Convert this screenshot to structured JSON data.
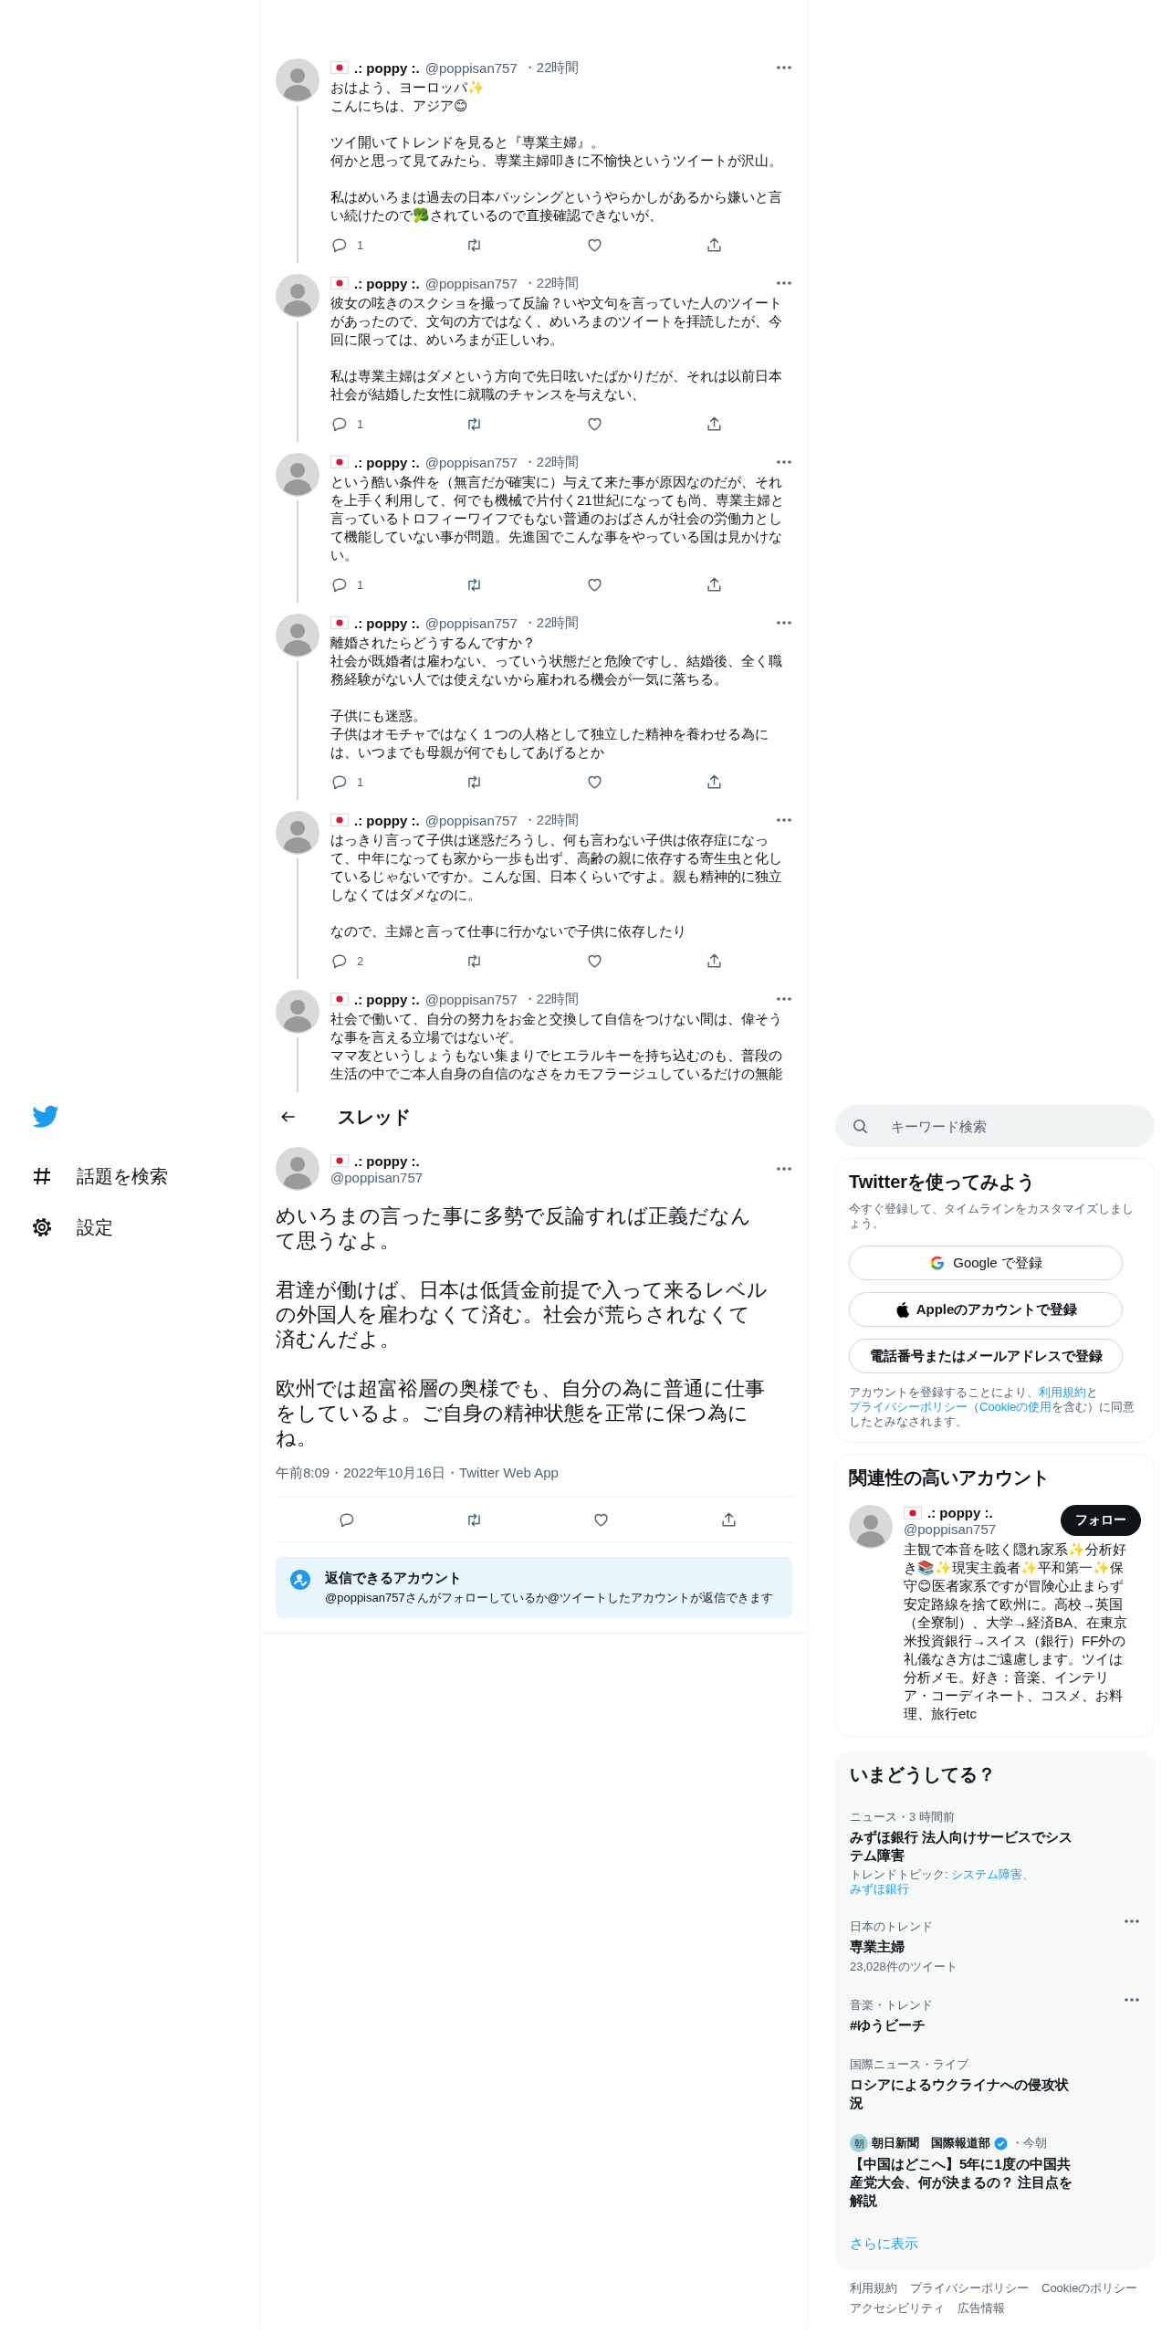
{
  "timeline": [
    {
      "name": ".: poppy :.",
      "handle": "@poppisan757",
      "time": "・22時間",
      "paragraphs": [
        [
          "おはよう、ヨーロッパ✨",
          "こんにちは、アジア😊"
        ],
        [
          "ツイ開いてトレンドを見ると『専業主婦』。",
          "何かと思って見てみたら、専業主婦叩きに不愉快というツイートが沢山。"
        ],
        [
          "私はめいろまは過去の日本バッシングというやらかしがあるから嫌いと言い続けたので🥦されているので直接確認できないが、"
        ]
      ],
      "actions": true,
      "replies": "1"
    },
    {
      "name": ".: poppy :.",
      "handle": "@poppisan757",
      "time": "・22時間",
      "paragraphs": [
        [
          "彼女の呟きのスクショを撮って反論？いや文句を言っていた人のツイートがあったので、文句の方ではなく、めいろまのツイートを拝読したが、今回に限っては、めいろまが正しいわ。"
        ],
        [
          "私は専業主婦はダメという方向で先日呟いたばかりだが、それは以前日本社会が結婚した女性に就職のチャンスを与えない、"
        ]
      ],
      "actions": true,
      "replies": "1"
    },
    {
      "name": ".: poppy :.",
      "handle": "@poppisan757",
      "time": "・22時間",
      "paragraphs": [
        [
          "という酷い条件を（無言だが確実に）与えて来た事が原因なのだが、それを上手く利用して、何でも機械で片付く21世紀になっても尚、専業主婦と言っているトロフィーワイフでもない普通のおばさんが社会の労働力として機能していない事が問題。先進国でこんな事をやっている国は見かけない。"
        ]
      ],
      "actions": true,
      "replies": "1"
    },
    {
      "name": ".: poppy :.",
      "handle": "@poppisan757",
      "time": "・22時間",
      "paragraphs": [
        [
          "離婚されたらどうするんですか？",
          "社会が既婚者は雇わない、っていう状態だと危険ですし、結婚後、全く職務経験がない人では使えないから雇われる機会が一気に落ちる。"
        ],
        [
          "子供にも迷惑。",
          "子供はオモチャではなく１つの人格として独立した精神を養わせる為には、いつまでも母親が何でもしてあげるとか"
        ]
      ],
      "actions": true,
      "replies": "1"
    },
    {
      "name": ".: poppy :.",
      "handle": "@poppisan757",
      "time": "・22時間",
      "paragraphs": [
        [
          "はっきり言って子供は迷惑だろうし、何も言わない子供は依存症になって、中年になっても家から一歩も出ず、高齢の親に依存する寄生虫と化しているじゃないですか。こんな国、日本くらいですよ。親も精神的に独立しなくてはダメなのに。"
        ],
        [
          "なので、主婦と言って仕事に行かないで子供に依存したり"
        ]
      ],
      "actions": true,
      "replies": "2"
    },
    {
      "name": ".: poppy :.",
      "handle": "@poppisan757",
      "time": "・22時間",
      "paragraphs": [
        [
          "社会で働いて、自分の努力をお金と交換して自信をつけない間は、偉そうな事を言える立場ではないぞ。",
          "ママ友というしょうもない集まりでヒエラルキーを持ち込むのも、普段の生活の中でご本人自身の自信のなさをカモフラージュしているだけの無能"
        ]
      ],
      "actions": false
    }
  ],
  "nav": [
    {
      "kind": "explore",
      "label": "話題を検索"
    },
    {
      "kind": "settings",
      "label": "設定"
    }
  ],
  "thread_header": {
    "title": "スレッド"
  },
  "main_tweet": {
    "name": ".: poppy :.",
    "handle": "@poppisan757",
    "paragraphs": [
      "めいろまの言った事に多勢で反論すれば正義だなんて思うなよ。",
      "君達が働けば、日本は低賃金前提で入って来るレベルの外国人を雇わなくて済む。社会が荒らされなくて済むんだよ。",
      "欧州では超富裕層の奥様でも、自分の為に普通に仕事をしているよ。ご自身の精神状態を正常に保つ為にね。"
    ],
    "meta": "午前8:09・2022年10月16日・Twitter Web App"
  },
  "reply_notice": {
    "title": "返信できるアカウント",
    "text": "@poppisan757さんがフォローしているか@ツイートしたアカウントが返信できます"
  },
  "search": {
    "placeholder": "キーワード検索"
  },
  "signup": {
    "title": "Twitterを使ってみよう",
    "subtitle": "今すぐ登録して、タイムラインをカスタマイズしましょう。",
    "buttons": [
      {
        "kind": "google",
        "label": "Google で登録"
      },
      {
        "kind": "apple",
        "label": "Appleのアカウントで登録"
      },
      {
        "kind": "phone",
        "label": "電話番号またはメールアドレスで登録"
      }
    ],
    "legal": [
      {
        "text": "アカウントを登録することにより、",
        "link": false
      },
      {
        "text": "利用規約",
        "link": true
      },
      {
        "text": "と",
        "link": false
      },
      {
        "text": "プライバシーポリシー",
        "link": true
      },
      {
        "text": "（",
        "link": false
      },
      {
        "text": "Cookieの使用",
        "link": true
      },
      {
        "text": "を含む）に同意したとみなされます。",
        "link": false
      }
    ]
  },
  "who_to_follow": {
    "title": "関連性の高いアカウント",
    "accounts": [
      {
        "name": ".: poppy :.",
        "handle": "@poppisan757",
        "button": "フォロー",
        "bio": "主観で本音を呟く隠れ家系✨分析好き📚✨現実主義者✨平和第一✨保守😊医者家系ですが冒険心止まらず安定路線を捨て欧州に。高校→英国（全寮制）、大学→経済BA、在東京米投資銀行→スイス（銀行）FF外の礼儀なき方はご遠慮します。ツイは分析メモ。好き：音楽、インテリア・コーディネート、コスメ、お料理、旅行etc"
      }
    ]
  },
  "trends": {
    "title": "いまどうしてる？",
    "items": [
      {
        "kind": "news",
        "context": "ニュース・3 時間前",
        "title": "みずほ銀行 法人向けサービスでシステム障害",
        "topics_label": "トレンドトピック: ",
        "topics": [
          "システム障害、",
          "みずほ銀行"
        ],
        "more": false
      },
      {
        "kind": "trend",
        "context": "日本のトレンド",
        "title": "専業主婦",
        "count": "23,028件のツイート",
        "more": true
      },
      {
        "kind": "trend",
        "context": "音楽・トレンド",
        "title": "#ゆうビーチ",
        "more": true
      },
      {
        "kind": "trend",
        "context": "国際ニュース・ライブ",
        "title": "ロシアによるウクライナへの侵攻状況",
        "more": false
      },
      {
        "kind": "article",
        "logo": "朝",
        "source": "朝日新聞　国際報道部",
        "verified": true,
        "time": "・今朝",
        "title": "【中国はどこへ】5年に1度の中国共産党大会、何が決まるの？ 注目点を解説",
        "more": false
      }
    ],
    "show_more": "さらに表示"
  },
  "footer": [
    "利用規約",
    "プライバシーポリシー",
    "Cookieのポリシー",
    "アクセシビリティ",
    "広告情報"
  ]
}
